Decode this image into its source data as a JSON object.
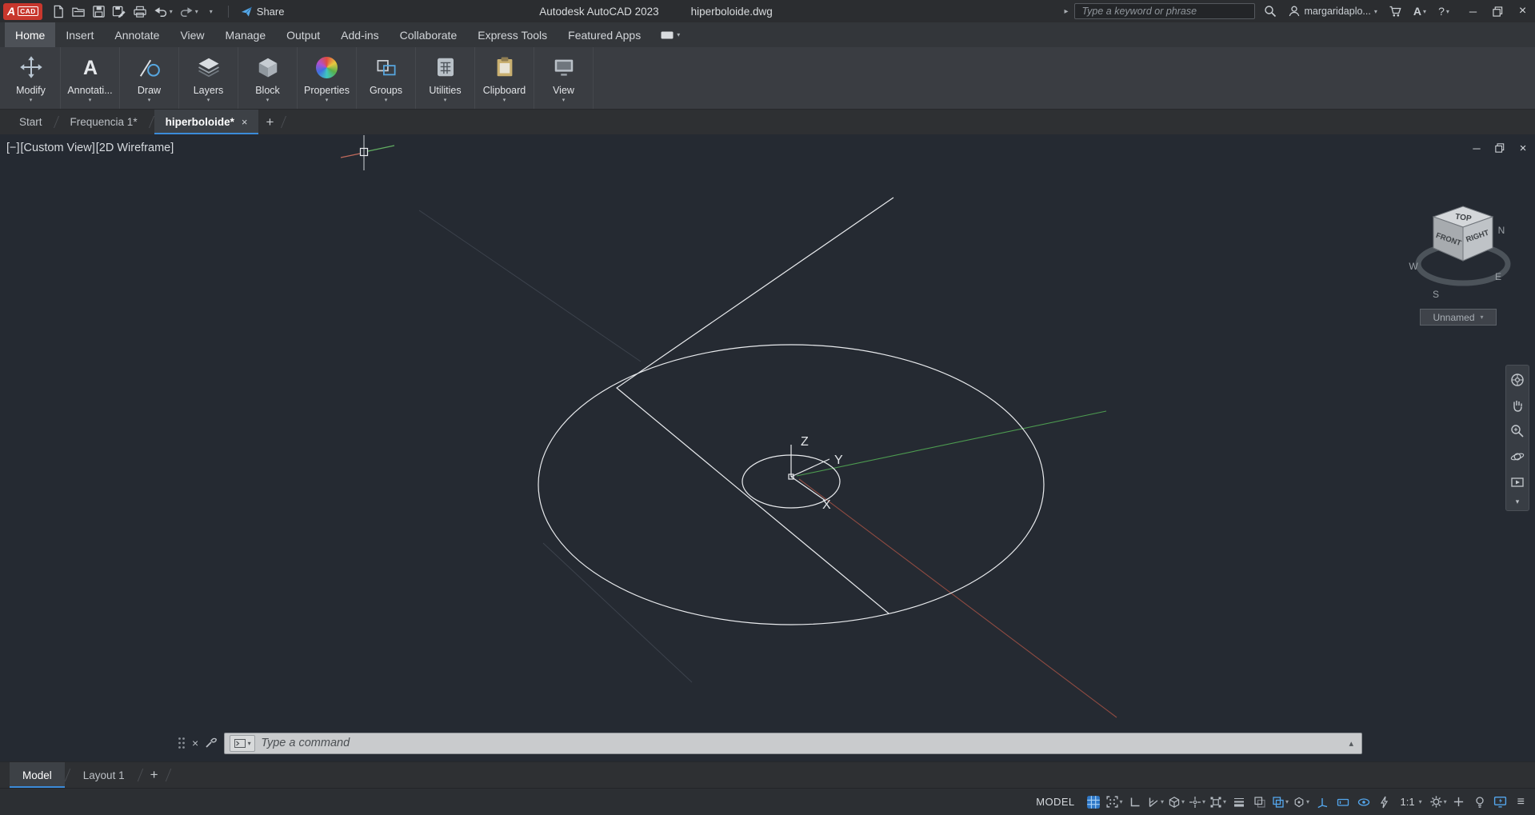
{
  "glyphs": {
    "plus": "+",
    "close": "×",
    "caret_down": "▾",
    "caret_up": "▴",
    "caret_right": "▸",
    "minimize": "─",
    "menu": "≡"
  },
  "titlebar": {
    "logo": {
      "a": "A",
      "cad": "CAD"
    },
    "share_label": "Share",
    "app_title": "Autodesk AutoCAD 2023",
    "doc_title": "hiperboloide.dwg",
    "search_placeholder": "Type a keyword or phrase",
    "user_name": "margaridaplo...",
    "autodesk_glyph": "A",
    "help_glyph": "?"
  },
  "menubar": {
    "tabs": [
      {
        "label": "Home",
        "active": true
      },
      {
        "label": "Insert"
      },
      {
        "label": "Annotate"
      },
      {
        "label": "View"
      },
      {
        "label": "Manage"
      },
      {
        "label": "Output"
      },
      {
        "label": "Add-ins"
      },
      {
        "label": "Collaborate"
      },
      {
        "label": "Express Tools"
      },
      {
        "label": "Featured Apps"
      }
    ]
  },
  "ribbon": {
    "annotation_glyph": "A",
    "panels": [
      {
        "label": "Modify"
      },
      {
        "label": "Annotati..."
      },
      {
        "label": "Draw"
      },
      {
        "label": "Layers"
      },
      {
        "label": "Block"
      },
      {
        "label": "Properties"
      },
      {
        "label": "Groups"
      },
      {
        "label": "Utilities"
      },
      {
        "label": "Clipboard"
      },
      {
        "label": "View"
      }
    ]
  },
  "file_tabs": {
    "tabs": [
      {
        "label": "Start"
      },
      {
        "label": "Frequencia 1*"
      },
      {
        "label": "hiperboloide*",
        "active": true
      }
    ]
  },
  "viewport": {
    "controls": [
      "[−]",
      "[Custom View]",
      "[2D Wireframe]"
    ],
    "viewcube": {
      "top": "TOP",
      "front": "FRONT",
      "right": "RIGHT",
      "north": "N",
      "east": "E",
      "south": "S",
      "west": "W"
    },
    "view_selector": "Unnamed",
    "axes": {
      "x": "X",
      "y": "Y",
      "z": "Z"
    }
  },
  "command_line": {
    "placeholder": "Type a command"
  },
  "layout_tabs": {
    "tabs": [
      {
        "label": "Model",
        "active": true
      },
      {
        "label": "Layout 1"
      }
    ]
  },
  "status_bar": {
    "model_label": "MODEL",
    "annotation_scale": "1:1"
  }
}
